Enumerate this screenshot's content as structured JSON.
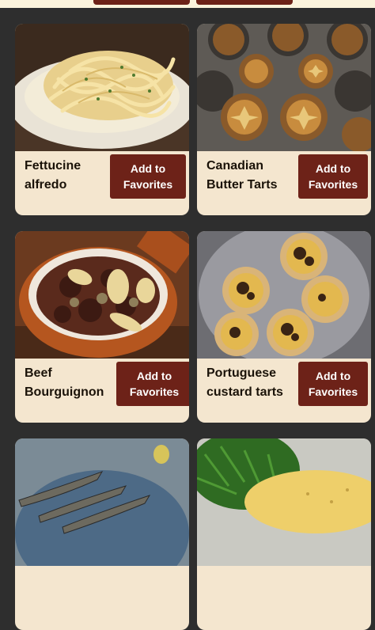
{
  "recipes": [
    {
      "title": "Fettucine alfredo",
      "button": "Add to Favorites",
      "image": "fettucine-alfredo-photo"
    },
    {
      "title": "Canadian Butter Tarts",
      "button": "Add to Favorites",
      "image": "butter-tarts-photo"
    },
    {
      "title": "Beef Bourguignon",
      "button": "Add to Favorites",
      "image": "beef-bourguignon-photo"
    },
    {
      "title": "Portuguese custard tarts",
      "button": "Add to Favorites",
      "image": "custard-tarts-photo"
    },
    {
      "title": "",
      "button": "",
      "image": "grilled-sardines-photo"
    },
    {
      "title": "",
      "button": "",
      "image": "omelette-salad-photo"
    }
  ]
}
